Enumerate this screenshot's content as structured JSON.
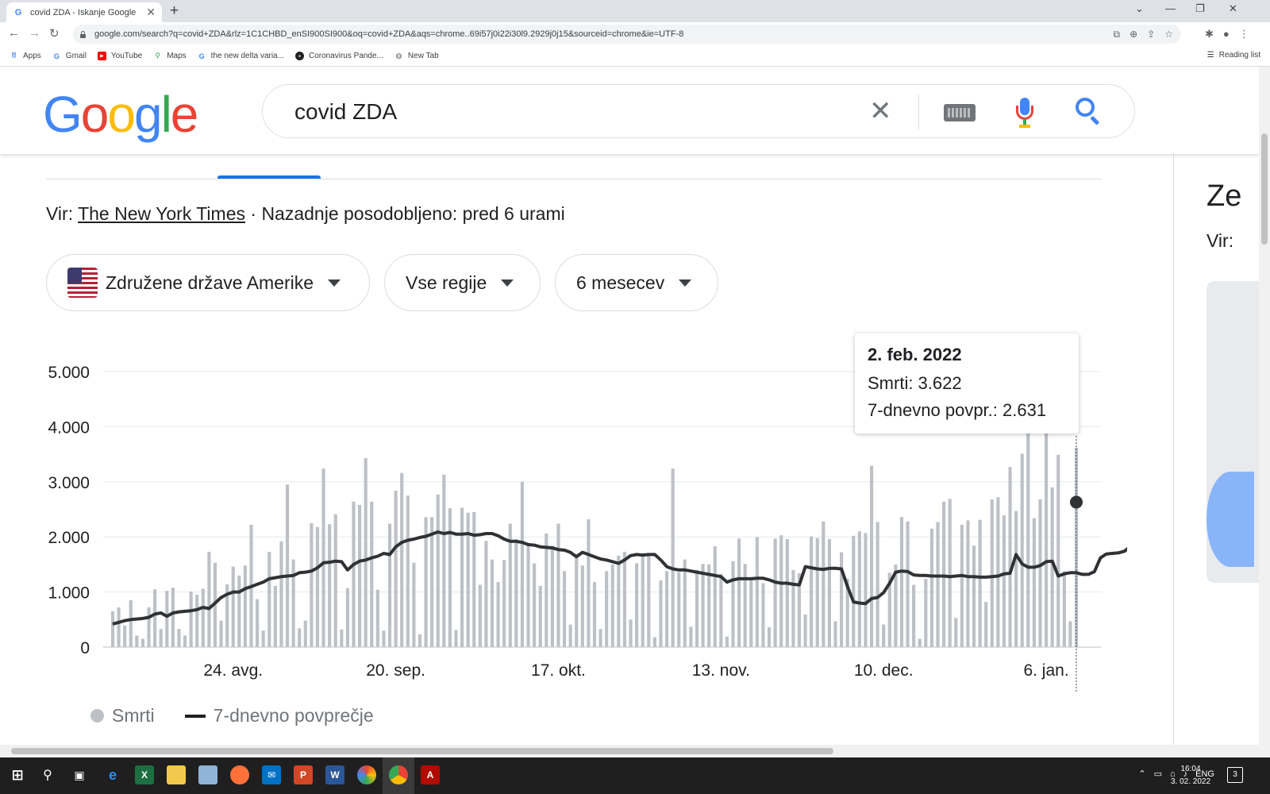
{
  "browser": {
    "tab_title": "covid ZDA - Iskanje Google",
    "url": "google.com/search?q=covid+ZDA&rlz=1C1CHBD_enSI900SI900&oq=covid+ZDA&aqs=chrome..69i57j0i22i30l9.2929j0j15&sourceid=chrome&ie=UTF-8",
    "bookmarks": [
      "Apps",
      "Gmail",
      "YouTube",
      "Maps",
      "the new delta varia...",
      "Coronavirus Pande...",
      "New Tab"
    ],
    "reading_list": "Reading list"
  },
  "search": {
    "logo": [
      "G",
      "o",
      "o",
      "g",
      "l",
      "e"
    ],
    "query": "covid ZDA"
  },
  "source": {
    "prefix": "Vir:",
    "name": "The New York Times",
    "updated": "· Nazadnje posodobljeno: pred 6 urami"
  },
  "filters": {
    "country": "Združene države Amerike",
    "region": "Vse regije",
    "period": "6 mesecev"
  },
  "tooltip": {
    "date": "2. feb. 2022",
    "deaths": "Smrti: 3.622",
    "avg": "7-dnevno povpr.: 2.631"
  },
  "legend": {
    "deaths": "Smrti",
    "avg": "7-dnevno povprečje"
  },
  "right_panel": {
    "title": "Ze",
    "vir": "Vir:"
  },
  "taskbar": {
    "lang": "ENG",
    "time": "16:04",
    "date": "3. 02. 2022",
    "notifications": "3"
  },
  "colors": {
    "bar": "#bdc1c6",
    "line": "#303134",
    "accent": "#1a73e8"
  },
  "chart_data": {
    "type": "bar",
    "title": "",
    "xlabel": "",
    "ylabel": "",
    "ylim": [
      0,
      5000
    ],
    "yticks": [
      "0",
      "1.000",
      "2.000",
      "3.000",
      "4.000",
      "5.000"
    ],
    "xticks": [
      {
        "label": "24. avg.",
        "index": 20
      },
      {
        "label": "20. sep.",
        "index": 47
      },
      {
        "label": "17. okt.",
        "index": 74
      },
      {
        "label": "13. nov.",
        "index": 101
      },
      {
        "label": "10. dec.",
        "index": 128
      },
      {
        "label": "6. jan.",
        "index": 155
      },
      {
        "label": "2. feb.",
        "index": 182
      }
    ],
    "grid": true,
    "legend_position": "bottom-left",
    "series": [
      {
        "name": "Smrti",
        "kind": "bar",
        "values": [
          650,
          720,
          390,
          850,
          210,
          150,
          720,
          1050,
          330,
          1020,
          1080,
          330,
          210,
          1010,
          950,
          1060,
          1730,
          1530,
          480,
          1140,
          1460,
          1300,
          1480,
          2220,
          870,
          300,
          1730,
          1110,
          1920,
          2950,
          1590,
          340,
          480,
          2250,
          2180,
          3240,
          2230,
          2410,
          320,
          1070,
          2640,
          2580,
          3430,
          2640,
          1040,
          300,
          2240,
          2840,
          3160,
          2750,
          1530,
          230,
          2360,
          2360,
          2770,
          3130,
          2520,
          310,
          2530,
          2440,
          2450,
          1130,
          1930,
          1590,
          1180,
          1580,
          2240,
          1960,
          3000,
          1860,
          1520,
          1110,
          2060,
          1840,
          2240,
          1380,
          410,
          1690,
          1480,
          2320,
          1180,
          330,
          1380,
          1500,
          1660,
          1730,
          500,
          1520,
          1700,
          1650,
          180,
          1210,
          1380,
          3240,
          1360,
          1590,
          370,
          1400,
          1510,
          1500,
          1830,
          1330,
          190,
          1560,
          1970,
          1510,
          1260,
          2000,
          1160,
          360,
          1970,
          2030,
          1960,
          1400,
          1340,
          590,
          2010,
          1980,
          2280,
          1960,
          470,
          1720,
          1240,
          2020,
          2100,
          2070,
          3290,
          2270,
          410,
          1350,
          1500,
          2360,
          2280,
          1130,
          150,
          1240,
          2150,
          2270,
          2640,
          2690,
          530,
          2220,
          2300,
          1840,
          2310,
          820,
          2680,
          2720,
          2390,
          3270,
          2470,
          3510,
          3930,
          2340,
          2680,
          3880,
          2900,
          3490,
          1380,
          470,
          3620
        ]
      },
      {
        "name": "7-dnevno povprečje",
        "kind": "line",
        "values": [
          420,
          450,
          480,
          500,
          510,
          520,
          540,
          600,
          620,
          560,
          620,
          640,
          650,
          660,
          680,
          720,
          700,
          800,
          900,
          960,
          1000,
          1000,
          1060,
          1100,
          1140,
          1180,
          1240,
          1260,
          1280,
          1290,
          1300,
          1350,
          1360,
          1380,
          1440,
          1530,
          1540,
          1560,
          1550,
          1400,
          1500,
          1560,
          1580,
          1620,
          1650,
          1700,
          1680,
          1820,
          1900,
          1940,
          1960,
          1990,
          2010,
          2050,
          2090,
          2060,
          2080,
          2050,
          2050,
          2060,
          2030,
          2040,
          2060,
          2060,
          2020,
          1960,
          1920,
          1920,
          1900,
          1860,
          1850,
          1820,
          1810,
          1800,
          1770,
          1760,
          1720,
          1640,
          1720,
          1680,
          1640,
          1600,
          1580,
          1550,
          1520,
          1580,
          1660,
          1680,
          1670,
          1680,
          1680,
          1580,
          1460,
          1420,
          1400,
          1400,
          1380,
          1360,
          1340,
          1320,
          1300,
          1280,
          1180,
          1220,
          1240,
          1240,
          1240,
          1250,
          1250,
          1220,
          1180,
          1160,
          1160,
          1140,
          1130,
          1460,
          1440,
          1420,
          1410,
          1430,
          1430,
          1420,
          1100,
          820,
          800,
          790,
          880,
          900,
          990,
          1160,
          1360,
          1380,
          1370,
          1310,
          1300,
          1300,
          1290,
          1290,
          1290,
          1280,
          1290,
          1300,
          1280,
          1280,
          1270,
          1270,
          1280,
          1290,
          1330,
          1340,
          1680,
          1510,
          1450,
          1450,
          1480,
          1550,
          1560,
          1290,
          1330,
          1350,
          1350,
          1320,
          1320,
          1370,
          1620,
          1690,
          1700,
          1710,
          1740,
          1830,
          1880,
          1920,
          1960,
          1950,
          1830,
          1890,
          1980,
          2010,
          2150,
          2150,
          2160,
          2350,
          2360,
          2440,
          2480,
          2470,
          2540,
          2550,
          2540,
          2600,
          2631
        ]
      }
    ]
  }
}
